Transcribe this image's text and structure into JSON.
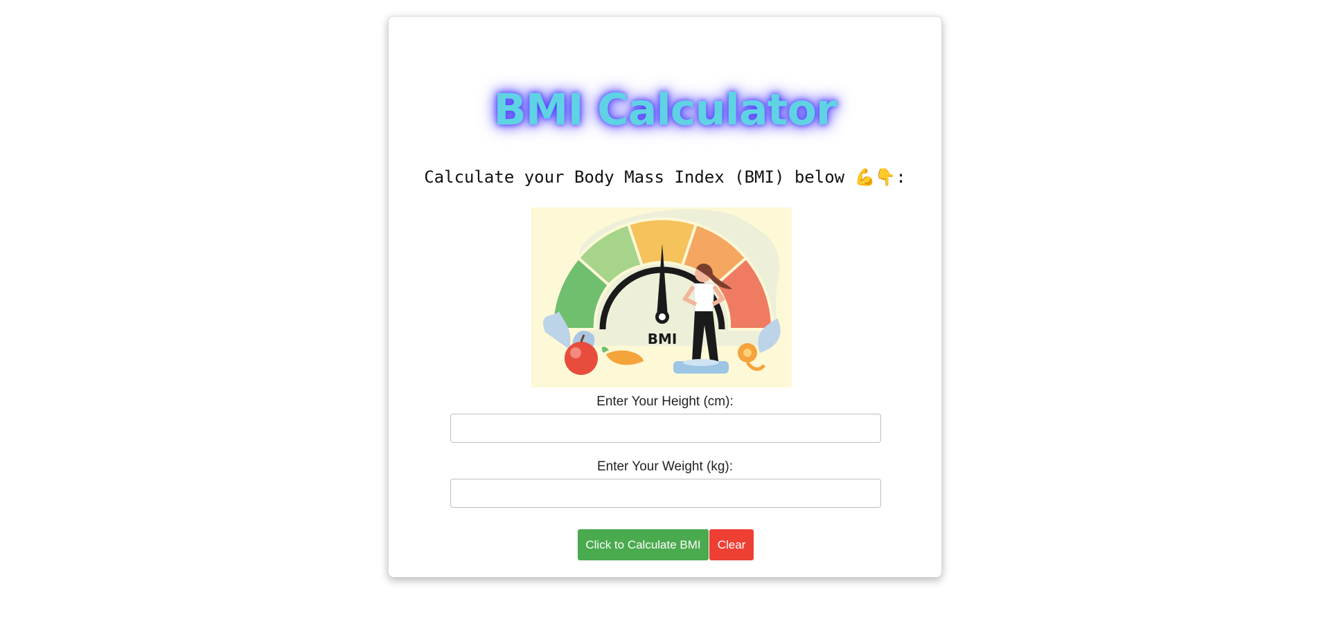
{
  "header": {
    "title": "BMI Calculator",
    "subtitle_text": "Calculate your Body Mass Index (BMI) below",
    "subtitle_emojis": "💪👇",
    "subtitle_suffix": ":"
  },
  "hero_image": {
    "label": "BMI",
    "icon": "bmi-gauge-illustration-icon"
  },
  "form": {
    "height_label": "Enter Your Height (cm):",
    "height_value": "",
    "weight_label": "Enter Your Weight (kg):",
    "weight_value": ""
  },
  "buttons": {
    "calculate_label": "Click to Calculate BMI",
    "clear_label": "Clear"
  },
  "colors": {
    "title": "#5fd3e3",
    "title_glow": "#5a4dff",
    "calculate_button": "#4aaa4e",
    "clear_button": "#ee3f35",
    "image_background": "#fdf8d6"
  }
}
